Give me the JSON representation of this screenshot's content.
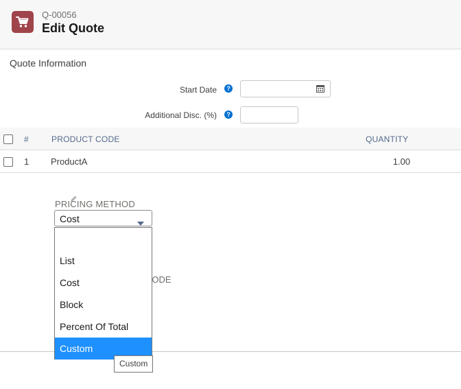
{
  "header": {
    "quote_number": "Q-00056",
    "title": "Edit Quote",
    "icon": "shopping-cart-icon",
    "icon_color": "#a0444b"
  },
  "quote_info": {
    "section_title": "Quote Information",
    "fields": [
      {
        "label": "Start Date",
        "value": "",
        "icon": "calendar-icon"
      },
      {
        "label": "Additional Disc. (%)",
        "value": ""
      }
    ]
  },
  "table": {
    "columns": [
      "#",
      "PRODUCT CODE",
      "QUANTITY"
    ],
    "rows": [
      {
        "number": "1",
        "product_code": "ProductA",
        "quantity": "1.00"
      }
    ]
  },
  "pricing": {
    "label": "PRICING METHOD",
    "selected": "Cost",
    "options": [
      "",
      "List",
      "Cost",
      "Block",
      "Percent Of Total",
      "Custom"
    ],
    "highlighted": "Custom",
    "tooltip": "Custom",
    "obscured_label": "CODE"
  },
  "colors": {
    "accent": "#0070d2",
    "highlight": "#1e90ff"
  }
}
